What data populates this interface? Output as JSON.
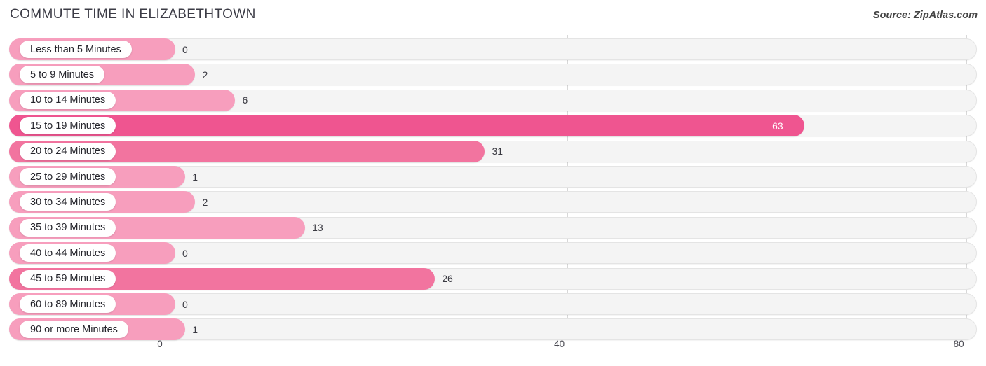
{
  "header": {
    "title": "COMMUTE TIME IN ELIZABETHTOWN",
    "source": "Source: ZipAtlas.com"
  },
  "colors": {
    "bar_light": "#f79ebd",
    "bar_mid": "#f2749f",
    "bar_strong": "#ef5590",
    "track": "#f4f4f4",
    "gridline": "#d8d8d8",
    "label_capsule": "#ffffff",
    "text": "#24242b"
  },
  "chart_data": {
    "type": "bar",
    "orientation": "horizontal",
    "title": "COMMUTE TIME IN ELIZABETHTOWN",
    "xlabel": "",
    "ylabel": "",
    "xlim": [
      0,
      80
    ],
    "xticks": [
      0,
      40,
      80
    ],
    "xtick_labels": [
      "0",
      "40",
      "80"
    ],
    "grid": true,
    "legend": false,
    "categories": [
      "Less than 5 Minutes",
      "5 to 9 Minutes",
      "10 to 14 Minutes",
      "15 to 19 Minutes",
      "20 to 24 Minutes",
      "25 to 29 Minutes",
      "30 to 34 Minutes",
      "35 to 39 Minutes",
      "40 to 44 Minutes",
      "45 to 59 Minutes",
      "60 to 89 Minutes",
      "90 or more Minutes"
    ],
    "values": [
      0,
      2,
      6,
      63,
      31,
      1,
      2,
      13,
      0,
      26,
      0,
      1
    ],
    "value_labels": [
      "0",
      "2",
      "6",
      "63",
      "31",
      "1",
      "2",
      "13",
      "0",
      "26",
      "0",
      "1"
    ]
  },
  "rows": [
    {
      "label": "Less than 5 Minutes",
      "value": 0,
      "value_label": "0",
      "tone": "light",
      "inside": false
    },
    {
      "label": "5 to 9 Minutes",
      "value": 2,
      "value_label": "2",
      "tone": "light",
      "inside": false
    },
    {
      "label": "10 to 14 Minutes",
      "value": 6,
      "value_label": "6",
      "tone": "light",
      "inside": false
    },
    {
      "label": "15 to 19 Minutes",
      "value": 63,
      "value_label": "63",
      "tone": "strong",
      "inside": true
    },
    {
      "label": "20 to 24 Minutes",
      "value": 31,
      "value_label": "31",
      "tone": "mid",
      "inside": false
    },
    {
      "label": "25 to 29 Minutes",
      "value": 1,
      "value_label": "1",
      "tone": "light",
      "inside": false
    },
    {
      "label": "30 to 34 Minutes",
      "value": 2,
      "value_label": "2",
      "tone": "light",
      "inside": false
    },
    {
      "label": "35 to 39 Minutes",
      "value": 13,
      "value_label": "13",
      "tone": "light",
      "inside": false
    },
    {
      "label": "40 to 44 Minutes",
      "value": 0,
      "value_label": "0",
      "tone": "light",
      "inside": false
    },
    {
      "label": "45 to 59 Minutes",
      "value": 26,
      "value_label": "26",
      "tone": "mid",
      "inside": false
    },
    {
      "label": "60 to 89 Minutes",
      "value": 0,
      "value_label": "0",
      "tone": "light",
      "inside": false
    },
    {
      "label": "90 or more Minutes",
      "value": 1,
      "value_label": "1",
      "tone": "light",
      "inside": false
    }
  ],
  "axis": {
    "ticks": [
      {
        "label": "0",
        "value": 0
      },
      {
        "label": "40",
        "value": 40
      },
      {
        "label": "80",
        "value": 80
      }
    ]
  }
}
